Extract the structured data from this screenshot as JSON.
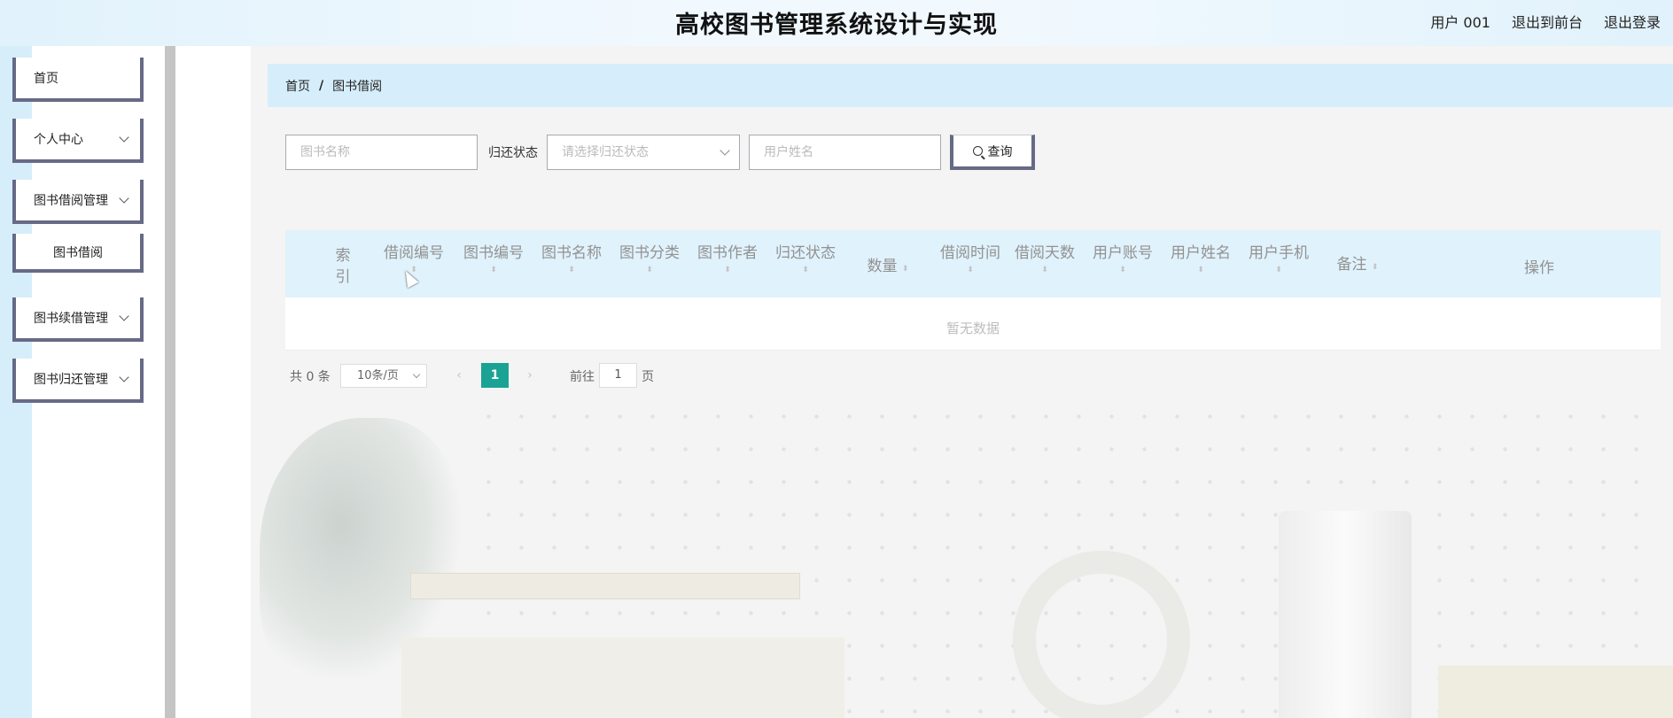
{
  "header": {
    "title": "高校图书管理系统设计与实现",
    "user": "用户 001",
    "to_front": "退出到前台",
    "logout": "退出登录"
  },
  "sidebar": {
    "items": [
      {
        "label": "首页",
        "has_children": false
      },
      {
        "label": "个人中心",
        "has_children": true
      },
      {
        "label": "图书借阅管理",
        "has_children": true
      },
      {
        "label": "图书借阅",
        "is_child": true
      },
      {
        "label": "图书续借管理",
        "has_children": true
      },
      {
        "label": "图书归还管理",
        "has_children": true
      }
    ]
  },
  "breadcrumb": {
    "home": "首页",
    "separator": "/",
    "current": "图书借阅"
  },
  "search": {
    "book_name_placeholder": "图书名称",
    "return_status_label": "归还状态",
    "return_status_placeholder": "请选择归还状态",
    "user_name_placeholder": "用户姓名",
    "search_button": "查询"
  },
  "table": {
    "columns": [
      "索引",
      "借阅编号",
      "图书编号",
      "图书名称",
      "图书分类",
      "图书作者",
      "归还状态",
      "数量",
      "借阅时间",
      "借阅天数",
      "用户账号",
      "用户姓名",
      "用户手机",
      "备注",
      "操作"
    ],
    "rows": [],
    "empty_text": "暂无数据"
  },
  "pagination": {
    "total_text": "共 0 条",
    "page_size": "10条/页",
    "prev": "‹",
    "current_page": "1",
    "next": "›",
    "goto_label": "前往",
    "goto_value": "1",
    "page_suffix": "页"
  },
  "colors": {
    "accent": "#666a86",
    "page_active": "#1aa394",
    "header_bg": "#e1f2fc",
    "table_head_bg": "#e0f2fc"
  }
}
